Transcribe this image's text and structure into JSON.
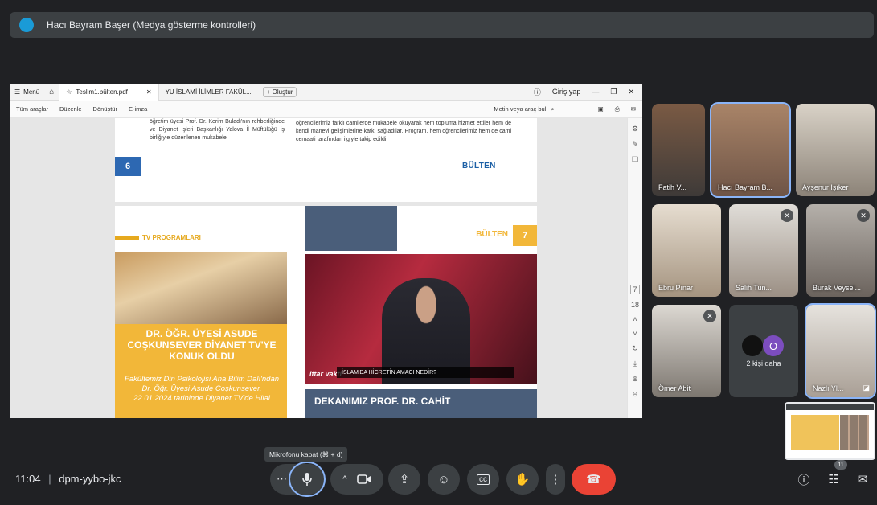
{
  "presenter_banner": {
    "text": "Hacı Bayram Başer (Medya gösterme kontrolleri)"
  },
  "pdf_viewer": {
    "menu_label": "Menü",
    "tabs": [
      {
        "label": "Teslim1.bülten.pdf",
        "active": true
      },
      {
        "label": "YU İSLAMİ İLİMLER FAKÜL..."
      }
    ],
    "new_tab_label": "+ Oluştur",
    "sign_in": "Giriş yap",
    "toolbar": [
      "Tüm araçlar",
      "Düzenle",
      "Dönüştür",
      "E-imza"
    ],
    "search_placeholder": "Metin veya araç bul",
    "page_current": "7",
    "page_total": "18"
  },
  "document": {
    "page1": {
      "left_text": "öğretim üyesi Prof. Dr. Kerim Buladı'nın rehberliğinde ve Diyanet İşleri Başkanlığı Yalova İl Müftülüğü iş birliğiyle düzenlenen mukabele",
      "right_text": "öğrencilerimiz farklı camilerde mukabele okuyarak hem topluma hizmet ettiler hem de kendi manevi gelişimlerine katkı sağladılar. Program, hem öğrencilerimiz hem de cami cemaati tarafından ilgiyle takip edildi.",
      "page_number": "6",
      "logo": "BÜLTEN"
    },
    "page2": {
      "section_title": "TV PROGRAMLARI",
      "left_headline": "DR. ÖĞR. ÜYESİ ASUDE COŞKUNSEVER DİYANET TV'YE KONUK OLDU",
      "left_body": "Fakültemiz Din Psikolojisi Ana Bilim Dalı'ndan Dr. Öğr. Üyesi Asude Coşkunsever, 22.01.2024 tarihinde Diyanet TV'de Hilal",
      "page_number": "7",
      "logo": "BÜLTEN",
      "video_brand": "iftar vakti",
      "video_caption": "İSLAM'DA HİCRETİN AMACI NEDİR?",
      "right_headline": "DEKANIMIZ PROF. DR. CAHİT"
    }
  },
  "participants": [
    {
      "name": "Fatih V...",
      "muted": false
    },
    {
      "name": "Hacı Bayram B...",
      "muted": false
    },
    {
      "name": "Ayşenur Işıker",
      "muted": false
    },
    {
      "name": "Ebru Pınar",
      "muted": false
    },
    {
      "name": "Salih Tun...",
      "muted": true
    },
    {
      "name": "Burak Veysel...",
      "muted": true
    },
    {
      "name": "Ömer Abit",
      "muted": true
    },
    {
      "name": "Nazlı Yl...",
      "muted": false
    }
  ],
  "more_tile": {
    "label": "2 kişi daha",
    "avatar_letter": "O"
  },
  "tooltip": "Mikrofonu kapat (⌘ + d)",
  "meeting": {
    "time": "11:04",
    "separator": "|",
    "code": "dpm-yybo-jkc"
  },
  "people_count": "11",
  "colors": {
    "background": "#202124",
    "control": "#3c4043",
    "end_call": "#ea4335",
    "focus": "#8ab4f8"
  }
}
